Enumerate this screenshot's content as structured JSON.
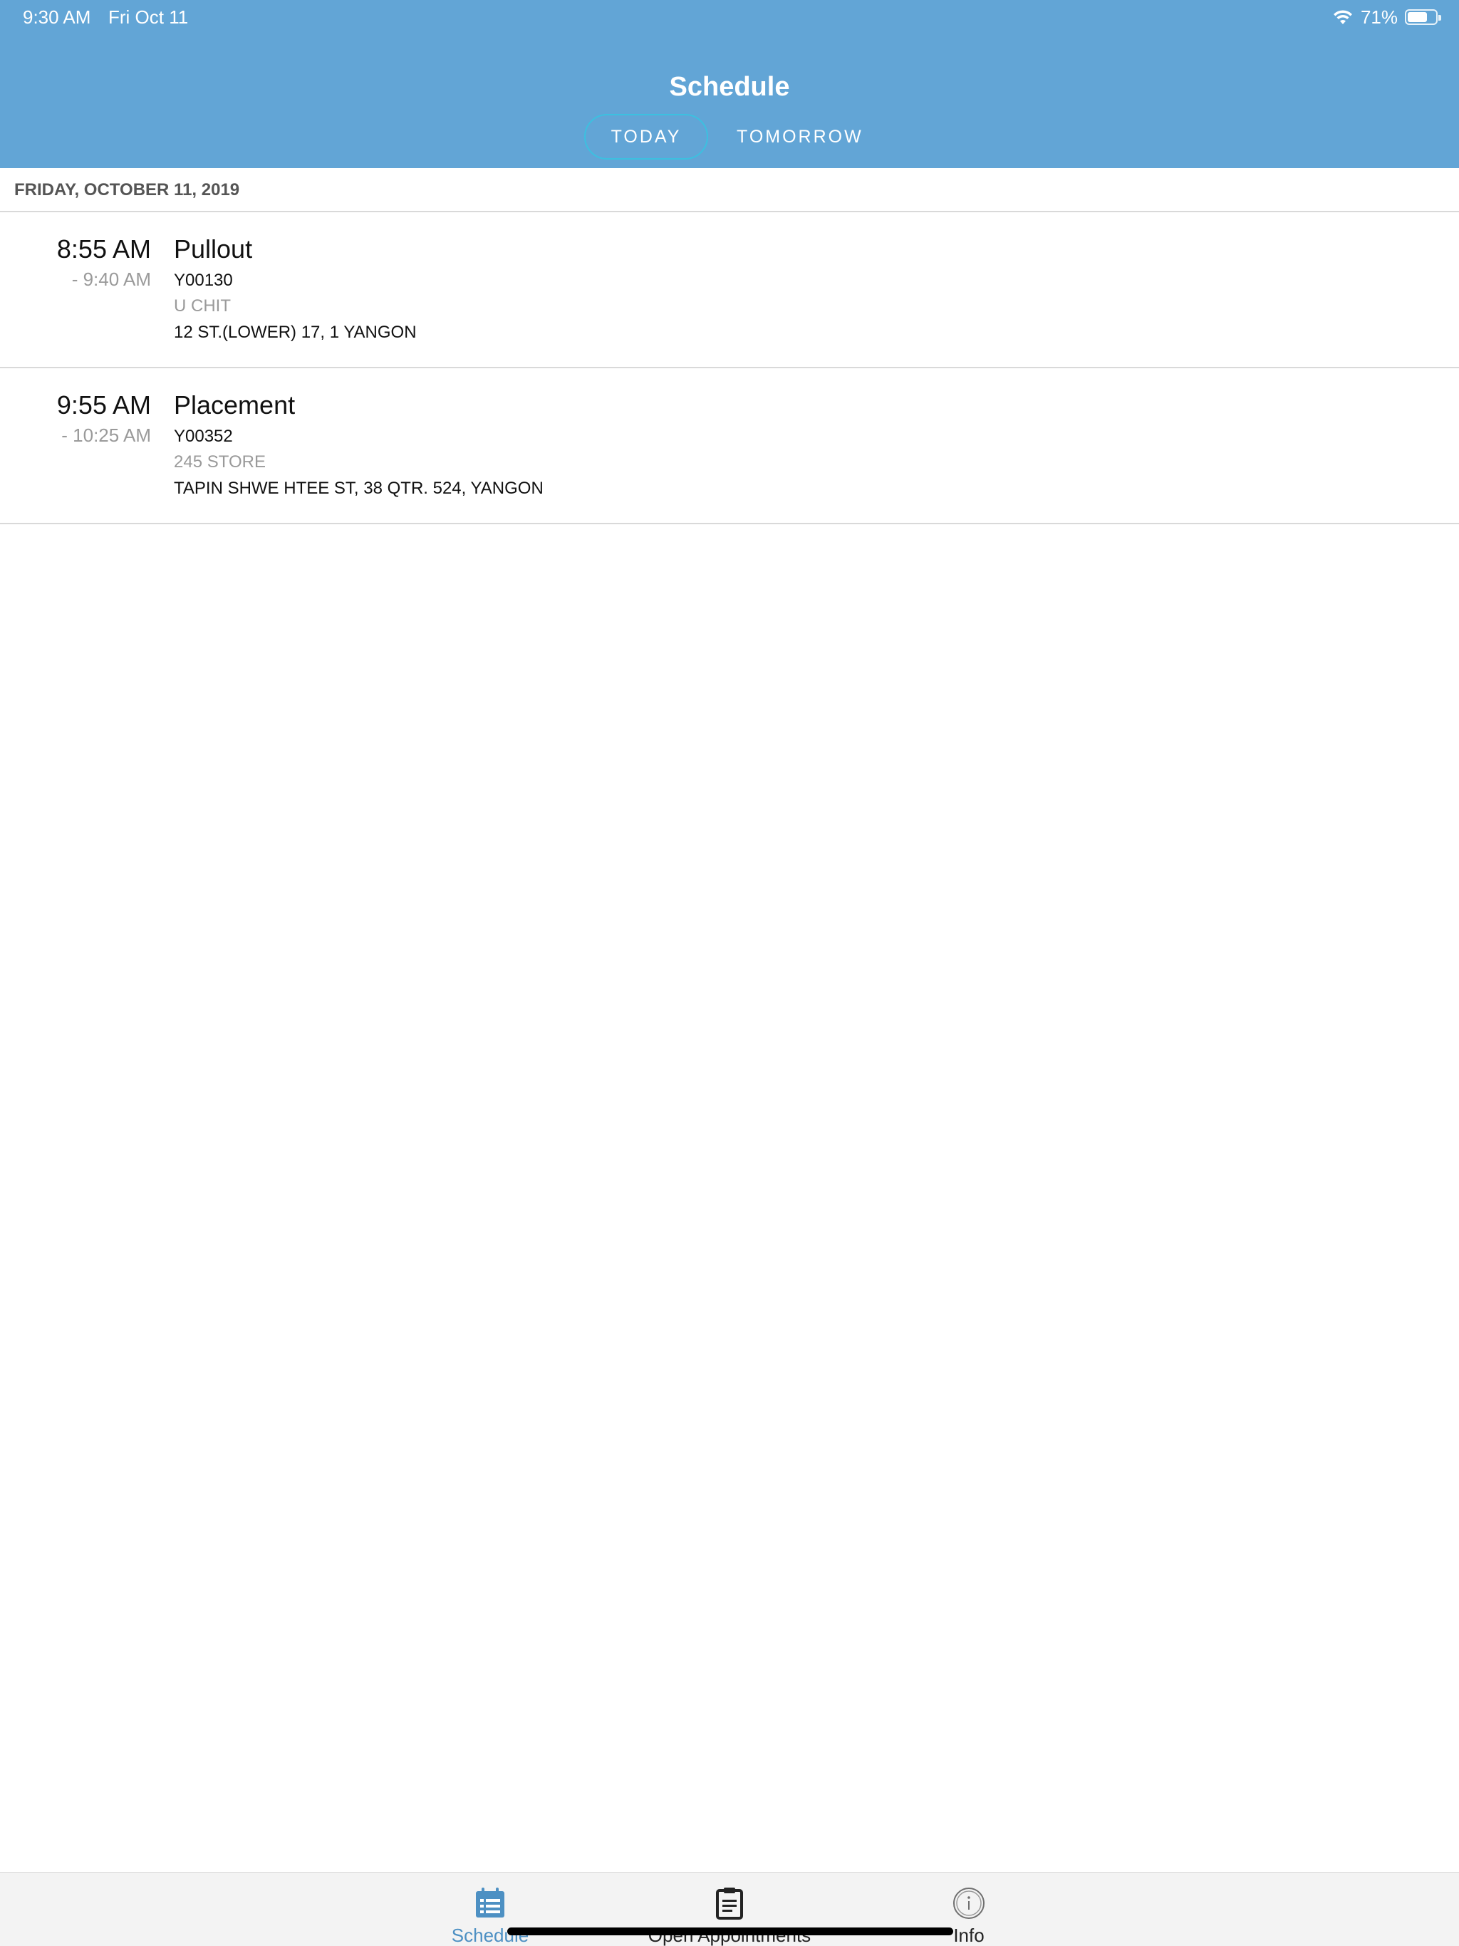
{
  "status_bar": {
    "time": "9:30 AM",
    "date": "Fri Oct 11",
    "battery": "71%",
    "battery_level": 0.71
  },
  "header": {
    "title": "Schedule",
    "tabs": [
      {
        "label": "TODAY",
        "active": true
      },
      {
        "label": "TOMORROW",
        "active": false
      }
    ]
  },
  "section": {
    "date_label": "FRIDAY, OCTOBER 11, 2019"
  },
  "appointments": [
    {
      "start": "8:55 AM",
      "end": "- 9:40 AM",
      "title": "Pullout",
      "id": "Y00130",
      "name": "U CHIT",
      "address": "12 ST.(LOWER) 17, 1 YANGON"
    },
    {
      "start": "9:55 AM",
      "end": "- 10:25 AM",
      "title": "Placement",
      "id": "Y00352",
      "name": "245 STORE",
      "address": "TAPIN SHWE HTEE ST, 38 QTR. 524, YANGON"
    }
  ],
  "tabbar": {
    "items": [
      {
        "label": "Schedule",
        "icon": "calendar-list-icon",
        "active": true
      },
      {
        "label": "Open Appointments",
        "icon": "clipboard-icon",
        "active": false
      },
      {
        "label": "Info",
        "icon": "info-icon",
        "active": false
      }
    ]
  },
  "colors": {
    "header_bg": "#62a5d6",
    "accent": "#4d90c3",
    "segment_border": "#3cc0e0"
  }
}
